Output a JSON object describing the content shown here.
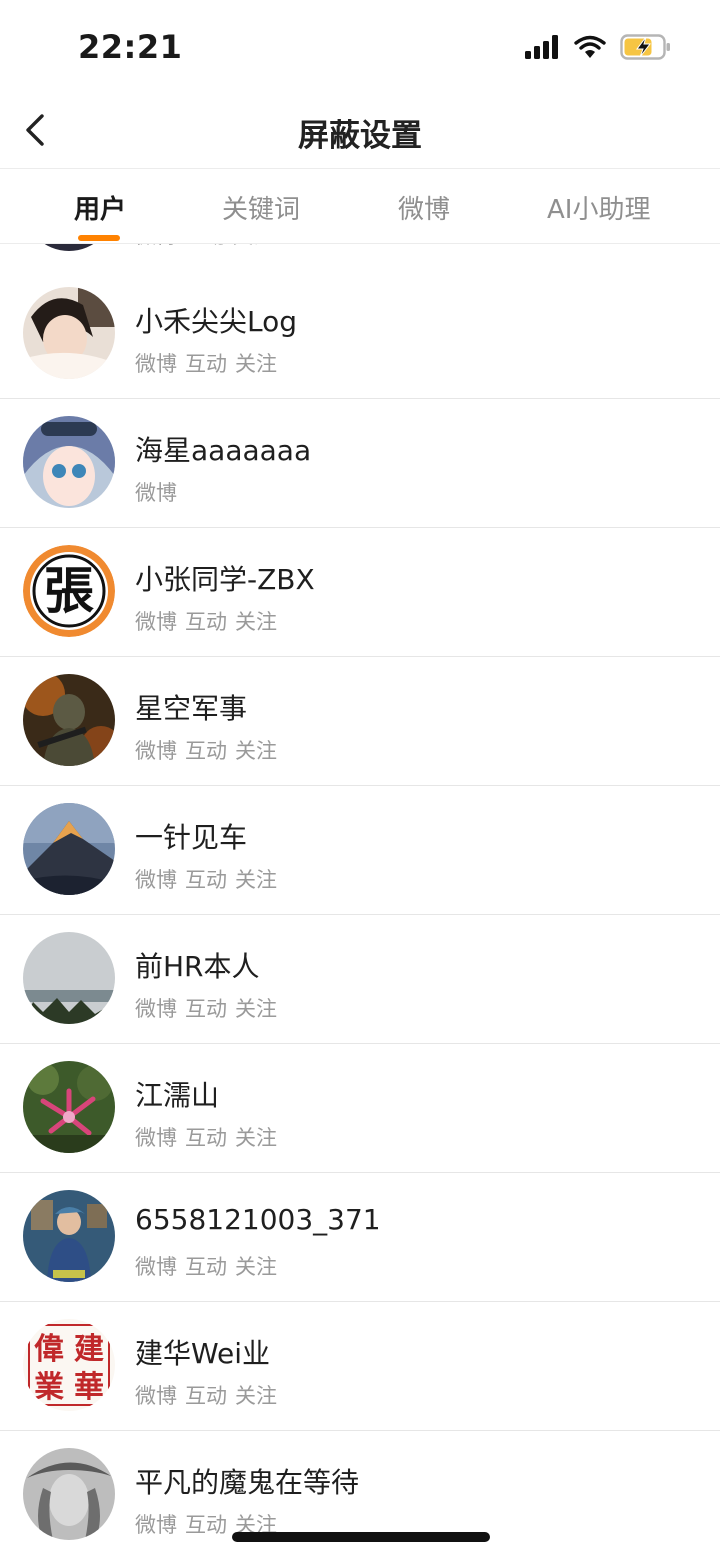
{
  "status_bar": {
    "time": "22:21"
  },
  "nav": {
    "title": "屏蔽设置"
  },
  "tabs": [
    {
      "label": "用户",
      "active": true
    },
    {
      "label": "关键词",
      "active": false
    },
    {
      "label": "微博",
      "active": false
    },
    {
      "label": "AI小助理",
      "active": false
    }
  ],
  "partial_row": {
    "meta": "微博 互动 关注"
  },
  "users": [
    {
      "name": "小禾尖尖Log",
      "tags": [
        "微博",
        "互动",
        "关注"
      ]
    },
    {
      "name": "海星aaaaaaa",
      "tags": [
        "微博"
      ]
    },
    {
      "name": "小张同学-ZBX",
      "tags": [
        "微博",
        "互动",
        "关注"
      ]
    },
    {
      "name": "星空军事",
      "tags": [
        "微博",
        "互动",
        "关注"
      ]
    },
    {
      "name": "一针见车",
      "tags": [
        "微博",
        "互动",
        "关注"
      ]
    },
    {
      "name": "前HR本人",
      "tags": [
        "微博",
        "互动",
        "关注"
      ]
    },
    {
      "name": "江濡山",
      "tags": [
        "微博",
        "互动",
        "关注"
      ]
    },
    {
      "name": "6558121003_371",
      "tags": [
        "微博",
        "互动",
        "关注"
      ]
    },
    {
      "name": "建华Wei业",
      "tags": [
        "微博",
        "互动",
        "关注"
      ]
    },
    {
      "name": "平凡的魔鬼在等待",
      "tags": [
        "微博",
        "互动",
        "关注"
      ]
    }
  ],
  "colors": {
    "accent": "#ff8200",
    "meta_text": "#9a9a9a",
    "divider": "#e6e6e6"
  },
  "avatar_glyphs": {
    "zhang": "張",
    "jianhua": [
      "偉",
      "建",
      "業",
      "華"
    ]
  },
  "icons": [
    "back-arrow-icon",
    "signal-icon",
    "wifi-icon",
    "battery-charging-icon"
  ]
}
